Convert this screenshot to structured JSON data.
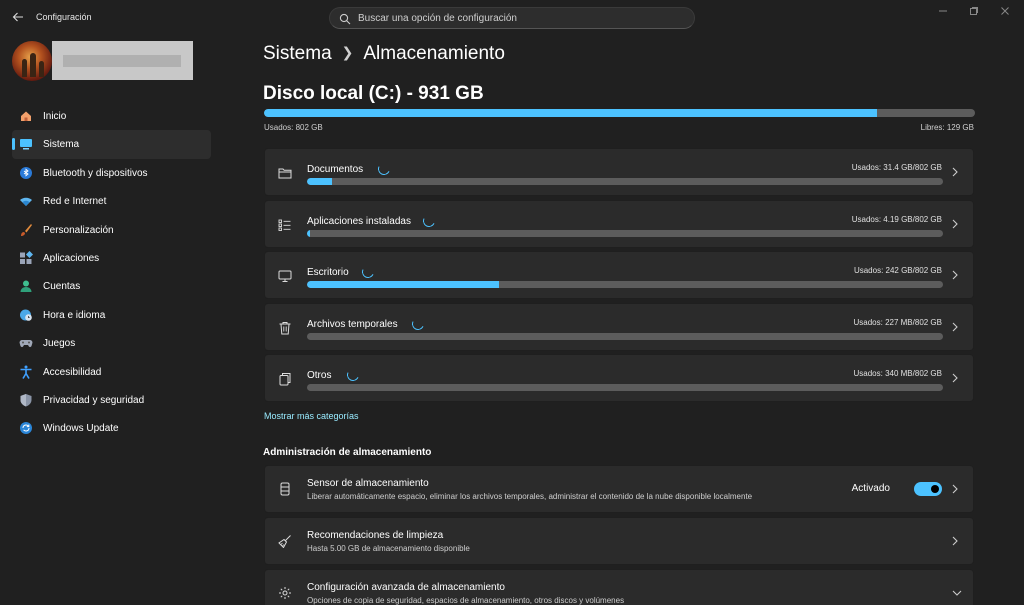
{
  "titlebar": {
    "app_title": "Configuración",
    "search_placeholder": "Buscar una opción de configuración"
  },
  "sidebar": {
    "items": [
      {
        "label": "Inicio",
        "icon": "home-icon",
        "active": false
      },
      {
        "label": "Sistema",
        "icon": "system-monitor-icon",
        "active": true
      },
      {
        "label": "Bluetooth y dispositivos",
        "icon": "bluetooth-icon",
        "active": false
      },
      {
        "label": "Red e Internet",
        "icon": "wifi-icon",
        "active": false
      },
      {
        "label": "Personalización",
        "icon": "brush-icon",
        "active": false
      },
      {
        "label": "Aplicaciones",
        "icon": "apps-icon",
        "active": false
      },
      {
        "label": "Cuentas",
        "icon": "account-icon",
        "active": false
      },
      {
        "label": "Hora e idioma",
        "icon": "clock-globe-icon",
        "active": false
      },
      {
        "label": "Juegos",
        "icon": "gamepad-icon",
        "active": false
      },
      {
        "label": "Accesibilidad",
        "icon": "accessibility-icon",
        "active": false
      },
      {
        "label": "Privacidad y seguridad",
        "icon": "shield-icon",
        "active": false
      },
      {
        "label": "Windows Update",
        "icon": "update-icon",
        "active": false
      }
    ]
  },
  "breadcrumb": {
    "parent": "Sistema",
    "current": "Almacenamiento"
  },
  "disk": {
    "title": "Disco local (C:) - 931 GB",
    "used_label": "Usados: 802 GB",
    "free_label": "Libres: 129 GB",
    "used_fraction": 0.862
  },
  "categories": [
    {
      "label": "Documentos",
      "usage": "Usados: 31.4 GB/802 GB",
      "fraction": 0.039,
      "icon": "folder-icon"
    },
    {
      "label": "Aplicaciones instaladas",
      "usage": "Usados: 4.19 GB/802 GB",
      "fraction": 0.005,
      "icon": "app-list-icon"
    },
    {
      "label": "Escritorio",
      "usage": "Usados: 242 GB/802 GB",
      "fraction": 0.302,
      "icon": "desktop-icon"
    },
    {
      "label": "Archivos temporales",
      "usage": "Usados: 227 MB/802 GB",
      "fraction": 0.0,
      "icon": "trash-icon"
    },
    {
      "label": "Otros",
      "usage": "Usados: 340 MB/802 GB",
      "fraction": 0.0,
      "icon": "others-icon"
    }
  ],
  "more_categories_link": "Mostrar más categorías",
  "management": {
    "section_title": "Administración de almacenamiento",
    "sensor": {
      "title": "Sensor de almacenamiento",
      "desc": "Liberar automáticamente espacio, eliminar los archivos temporales, administrar el contenido de la nube disponible localmente",
      "toggle_label": "Activado",
      "enabled": true
    },
    "cleanup": {
      "title": "Recomendaciones de limpieza",
      "desc": "Hasta 5.00 GB de almacenamiento disponible"
    },
    "advanced": {
      "title": "Configuración avanzada de almacenamiento",
      "desc": "Opciones de copia de seguridad, espacios de almacenamiento, otros discos y volúmenes"
    }
  },
  "colors": {
    "accent": "#4cc2ff",
    "background": "#202020",
    "card": "#2b2b2b",
    "link": "#99ebff"
  }
}
